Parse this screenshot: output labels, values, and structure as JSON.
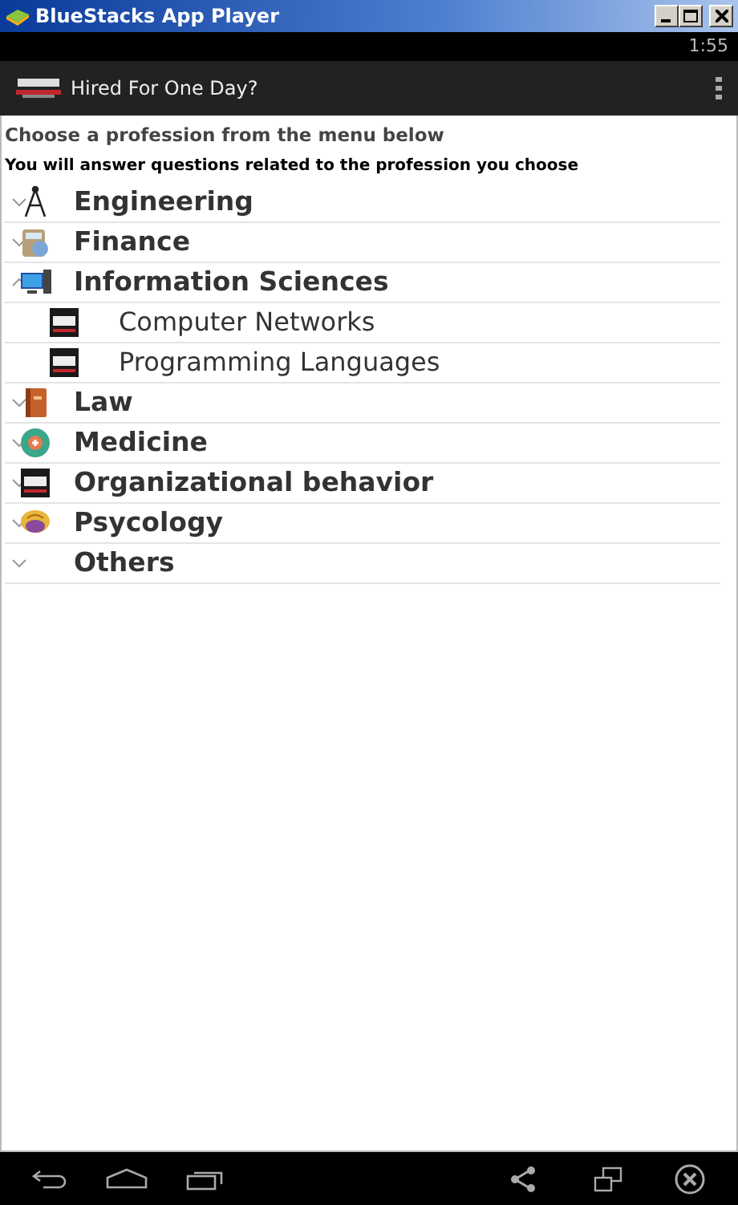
{
  "window": {
    "title": "BlueStacks App Player"
  },
  "status_bar": {
    "time": "1:55"
  },
  "action_bar": {
    "title": "Hired For One Day?"
  },
  "intro": [
    "Choose a profession from the menu below",
    "You will answer questions related to the profession you choose"
  ],
  "professions": [
    {
      "label": "Engineering",
      "expanded": false
    },
    {
      "label": "Finance",
      "expanded": false
    },
    {
      "label": "Information Sciences",
      "expanded": true,
      "children": [
        {
          "label": "Computer Networks"
        },
        {
          "label": "Programming Languages"
        }
      ]
    },
    {
      "label": "Law",
      "expanded": false
    },
    {
      "label": "Medicine",
      "expanded": false
    },
    {
      "label": "Organizational behavior",
      "expanded": false
    },
    {
      "label": "Psycology",
      "expanded": false
    },
    {
      "label": "Others",
      "expanded": false
    }
  ]
}
